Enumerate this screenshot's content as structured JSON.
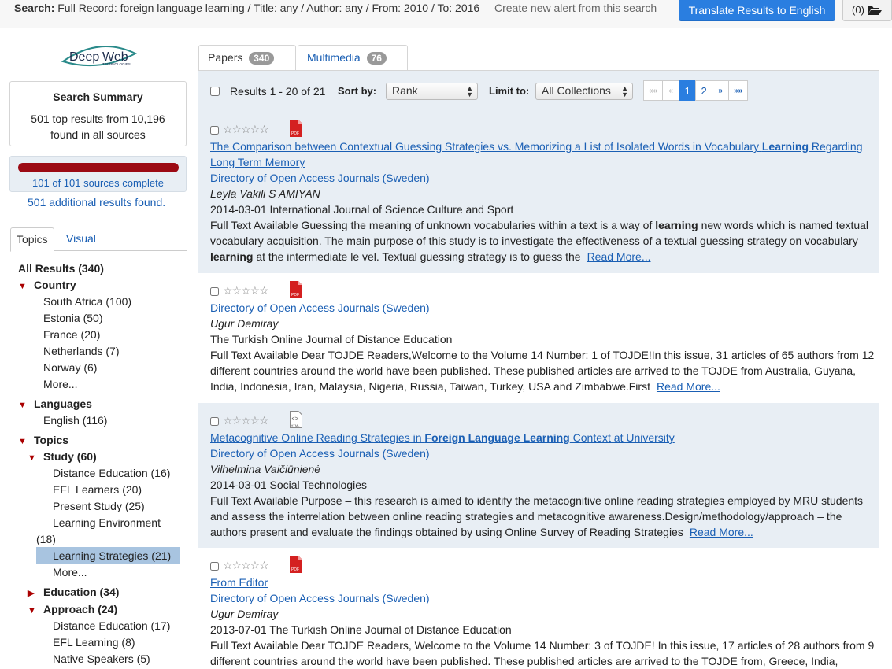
{
  "topbar": {
    "search_label": "Search:",
    "search_query": "Full Record: foreign language learning / Title: any / Author: any / From: 2010 / To: 2016",
    "alert_link": "Create new alert from this search",
    "translate_button": "Translate Results to English",
    "folder_count": "(0)"
  },
  "brand": {
    "logo_text_1": "Deep",
    "logo_text_2": "Web",
    "logo_sub": "TECHNOLOGIES"
  },
  "summary": {
    "title": "Search Summary",
    "text": "501 top results from 10,196 found in all sources",
    "progress_fraction": 1.0,
    "progress_text": "101 of 101 sources complete",
    "additional_text": "501 additional results found."
  },
  "side_tabs": {
    "topics": "Topics",
    "visual": "Visual"
  },
  "facets": [
    {
      "label": "All Results (340)",
      "bold": true,
      "tri": ""
    },
    {
      "label": "Country",
      "bold": true,
      "tri": "▼"
    },
    {
      "label": "South Africa (100)",
      "bold": false,
      "tri": ""
    },
    {
      "label": "Estonia (50)",
      "bold": false,
      "tri": ""
    },
    {
      "label": "France (20)",
      "bold": false,
      "tri": ""
    },
    {
      "label": "Netherlands (7)",
      "bold": false,
      "tri": ""
    },
    {
      "label": "Norway (6)",
      "bold": false,
      "tri": ""
    },
    {
      "label": "More...",
      "bold": false,
      "tri": ""
    },
    {
      "label": "Languages",
      "bold": true,
      "tri": "▼"
    },
    {
      "label": "English (116)",
      "bold": false,
      "tri": ""
    },
    {
      "label": "Topics",
      "bold": true,
      "tri": "▼"
    },
    {
      "label": "Study (60)",
      "bold": true,
      "tri": "▼"
    },
    {
      "label": "Distance Education (16)",
      "bold": false,
      "tri": ""
    },
    {
      "label": "EFL Learners (20)",
      "bold": false,
      "tri": ""
    },
    {
      "label": "Present Study (25)",
      "bold": false,
      "tri": ""
    },
    {
      "label": "Learning Environment",
      "bold": false,
      "tri": ""
    },
    {
      "label": "(18)",
      "bold": false,
      "tri": ""
    },
    {
      "label": "Learning Strategies (21)",
      "bold": false,
      "tri": ""
    },
    {
      "label": "More...",
      "bold": false,
      "tri": ""
    },
    {
      "label": "Education (34)",
      "bold": true,
      "tri": "▶"
    },
    {
      "label": "Approach (24)",
      "bold": true,
      "tri": "▼"
    },
    {
      "label": "Distance Education (17)",
      "bold": false,
      "tri": ""
    },
    {
      "label": "EFL Learning (8)",
      "bold": false,
      "tri": ""
    },
    {
      "label": "Native Speakers (5)",
      "bold": false,
      "tri": ""
    }
  ],
  "tabs": {
    "papers": "Papers",
    "papers_count": "340",
    "multimedia": "Multimedia",
    "multimedia_count": "76"
  },
  "toolbar": {
    "results_text": "Results 1 - 20 of 21",
    "sort_label": "Sort by:",
    "sort_value": "Rank",
    "limit_label": "Limit to:",
    "limit_value": "All Collections",
    "pager": [
      "««",
      "«",
      "1",
      "2",
      "»",
      "»»"
    ]
  },
  "results": [
    {
      "icon": "pdf-icon",
      "title_parts": [
        "The Comparison between Contextual Guessing Strategies vs. Memorizing a List of Isolated Words in Vocabulary ",
        "Learning",
        " Regarding Long Term Memory"
      ],
      "source": "Directory of Open Access Journals (Sweden)",
      "author": "Leyla Vakili S AMIYAN",
      "date_journal": "2014-03-01 International Journal of Science Culture and Sport",
      "snippet_parts": [
        "Full Text Available Guessing the meaning of unknown vocabularies within a text is a way of ",
        "learning",
        " new words which is named textual vocabulary acquisition. The main purpose of this study is to investigate the effectiveness of a textual guessing strategy on vocabulary ",
        "learning",
        " at the intermediate le vel. Textual guessing strategy is to guess the"
      ],
      "read_more": "Read More..."
    },
    {
      "icon": "pdf-icon",
      "source": "Directory of Open Access Journals (Sweden)",
      "author": "Ugur Demiray",
      "date_journal": "The Turkish Online Journal of Distance Education",
      "snippet": "Full Text Available Dear TOJDE Readers,Welcome to the Volume 14 Number: 1 of TOJDE!In this issue, 31 articles of 65 authors from 12 different countries around the world have been published. These published articles are arrived to the TOJDE from Australia, Guyana, India, Indonesia, Iran, Malaysia, Nigeria, Russia, Taiwan, Turkey, USA and Zimbabwe.First",
      "read_more": "Read More..."
    },
    {
      "icon": "html-icon",
      "icon_label": "<>",
      "icon_sub": "HTML",
      "title_parts": [
        "Metacognitive Online Reading Strategies in ",
        "Foreign Language Learning",
        " Context at University"
      ],
      "source": "Directory of Open Access Journals (Sweden)",
      "author": "Vilhelmina Vaičiūnienė",
      "date_journal": "2014-03-01 Social Technologies",
      "snippet": "Full Text Available Purpose – this research is aimed to identify the metacognitive online reading strategies employed by MRU students and assess the interrelation between online reading strategies and metacognitive awareness.Design/methodology/approach – the authors present and evaluate the findings obtained by using Online Survey of Reading Strategies",
      "read_more": "Read More..."
    },
    {
      "icon": "pdf-icon",
      "title": "From Editor",
      "source": "Directory of Open Access Journals (Sweden)",
      "author": "Ugur Demiray",
      "date_journal": "2013-07-01 The Turkish Online Journal of Distance Education",
      "snippet": "Full Text Available Dear TOJDE Readers, Welcome to the Volume 14 Number: 3 of TOJDE! In this issue, 17 articles of 28 authors from 9 different countries around the world have been published. These published articles are arrived to the TOJDE from, Greece, India,"
    }
  ],
  "pdf_label": "PDF",
  "star_glyphs": "☆☆☆☆☆",
  "colors": {
    "accent": "#2a7ee0",
    "link": "#1a5fb4",
    "progress": "#9c0a14",
    "pdf": "#d42020",
    "shade": "#e8eef4"
  }
}
